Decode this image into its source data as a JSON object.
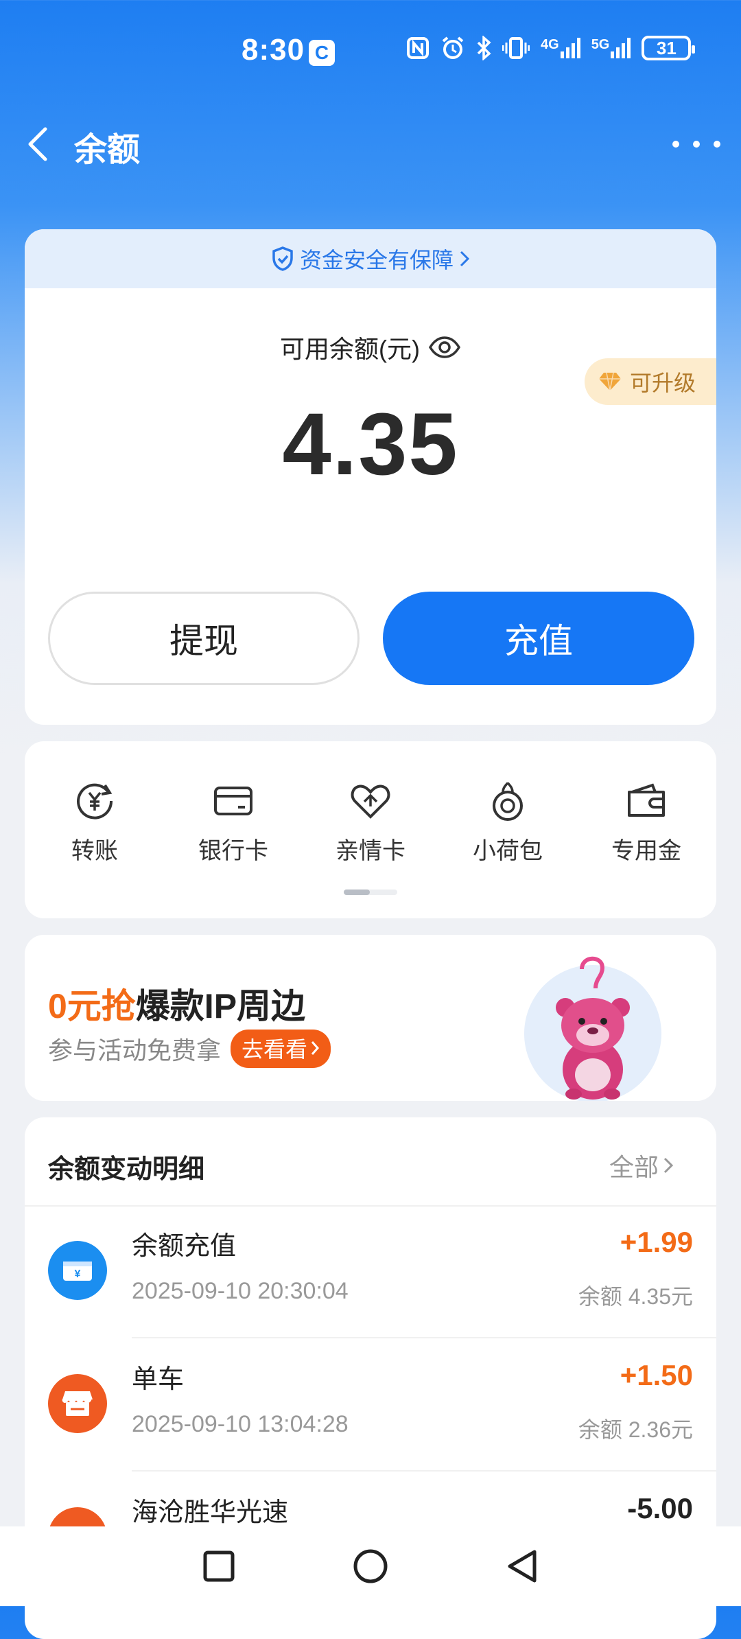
{
  "status": {
    "time": "8:30",
    "badge": "C",
    "net1": "4G",
    "net2": "5G",
    "battery": "31"
  },
  "header": {
    "title": "余额"
  },
  "balance_card": {
    "safety_text": "资金安全有保障",
    "available_label": "可用余额(元)",
    "upgrade_label": "可升级",
    "amount": "4.35",
    "withdraw_label": "提现",
    "recharge_label": "充值"
  },
  "quick_actions": [
    {
      "label": "转账",
      "icon": "yuan-transfer-icon"
    },
    {
      "label": "银行卡",
      "icon": "bank-card-icon"
    },
    {
      "label": "亲情卡",
      "icon": "family-card-icon"
    },
    {
      "label": "小荷包",
      "icon": "small-purse-icon"
    },
    {
      "label": "专用金",
      "icon": "wallet-icon"
    }
  ],
  "promo": {
    "title_highlight": "0元抢",
    "title_rest": "爆款IP周边",
    "subtitle": "参与活动免费拿",
    "button": "去看看"
  },
  "details": {
    "title": "余额变动明细",
    "all_label": "全部",
    "rows": [
      {
        "name": "余额充值",
        "time": "2025-09-10 20:30:04",
        "amount": "+1.99",
        "balance": "余额 4.35元",
        "icon_color": "#1b8ef0"
      },
      {
        "name": "单车",
        "time": "2025-09-10 13:04:28",
        "amount": "+1.50",
        "balance": "余额 2.36元",
        "icon_color": "#ef5a22"
      },
      {
        "name": "海沧胜华光速",
        "time": "",
        "amount": "-5.00",
        "balance": "",
        "icon_color": "#ef5a22"
      }
    ]
  },
  "colors": {
    "primary": "#1677f5",
    "accent_orange": "#f36b17"
  }
}
